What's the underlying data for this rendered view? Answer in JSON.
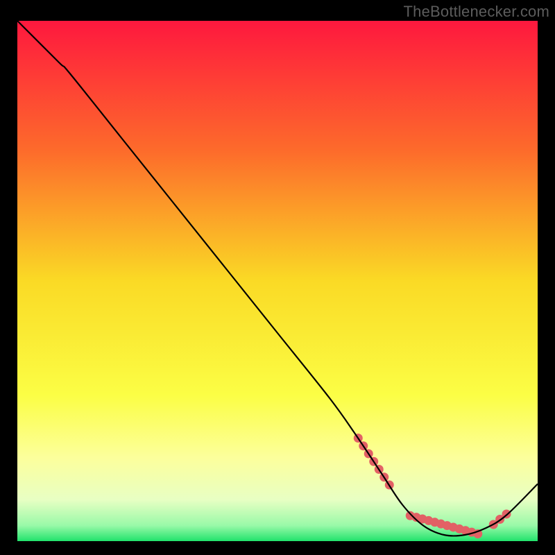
{
  "watermark": "TheBottlenecker.com",
  "chart_data": {
    "type": "line",
    "title": "",
    "xlabel": "",
    "ylabel": "",
    "xlim": [
      0,
      100
    ],
    "ylim": [
      0,
      100
    ],
    "curve": [
      [
        0,
        100
      ],
      [
        8,
        92
      ],
      [
        10,
        90
      ],
      [
        20,
        77.5
      ],
      [
        30,
        65
      ],
      [
        40,
        52.5
      ],
      [
        50,
        40
      ],
      [
        60,
        27.5
      ],
      [
        65,
        20.5
      ],
      [
        70,
        13
      ],
      [
        74,
        7
      ],
      [
        78,
        3
      ],
      [
        82,
        1.2
      ],
      [
        86,
        1.2
      ],
      [
        90,
        2.5
      ],
      [
        94,
        5
      ],
      [
        100,
        11
      ]
    ],
    "dot_segments": [
      {
        "start": [
          65.5,
          19.8
        ],
        "end": [
          71.5,
          10.8
        ],
        "count": 7
      },
      {
        "start": [
          75.5,
          4.9
        ],
        "end": [
          88.5,
          1.4
        ],
        "count": 12
      },
      {
        "start": [
          91.5,
          3.2
        ],
        "end": [
          94.0,
          5.2
        ],
        "count": 3
      }
    ],
    "gradient_stops": [
      {
        "offset": 0,
        "color": "#fe183e"
      },
      {
        "offset": 0.25,
        "color": "#fd6b2b"
      },
      {
        "offset": 0.5,
        "color": "#fada25"
      },
      {
        "offset": 0.72,
        "color": "#fbfe45"
      },
      {
        "offset": 0.84,
        "color": "#fcff9c"
      },
      {
        "offset": 0.92,
        "color": "#e8ffc3"
      },
      {
        "offset": 0.97,
        "color": "#99f9a8"
      },
      {
        "offset": 1.0,
        "color": "#21e36c"
      }
    ],
    "dot_color": "#e26165",
    "line_color": "#000000"
  }
}
